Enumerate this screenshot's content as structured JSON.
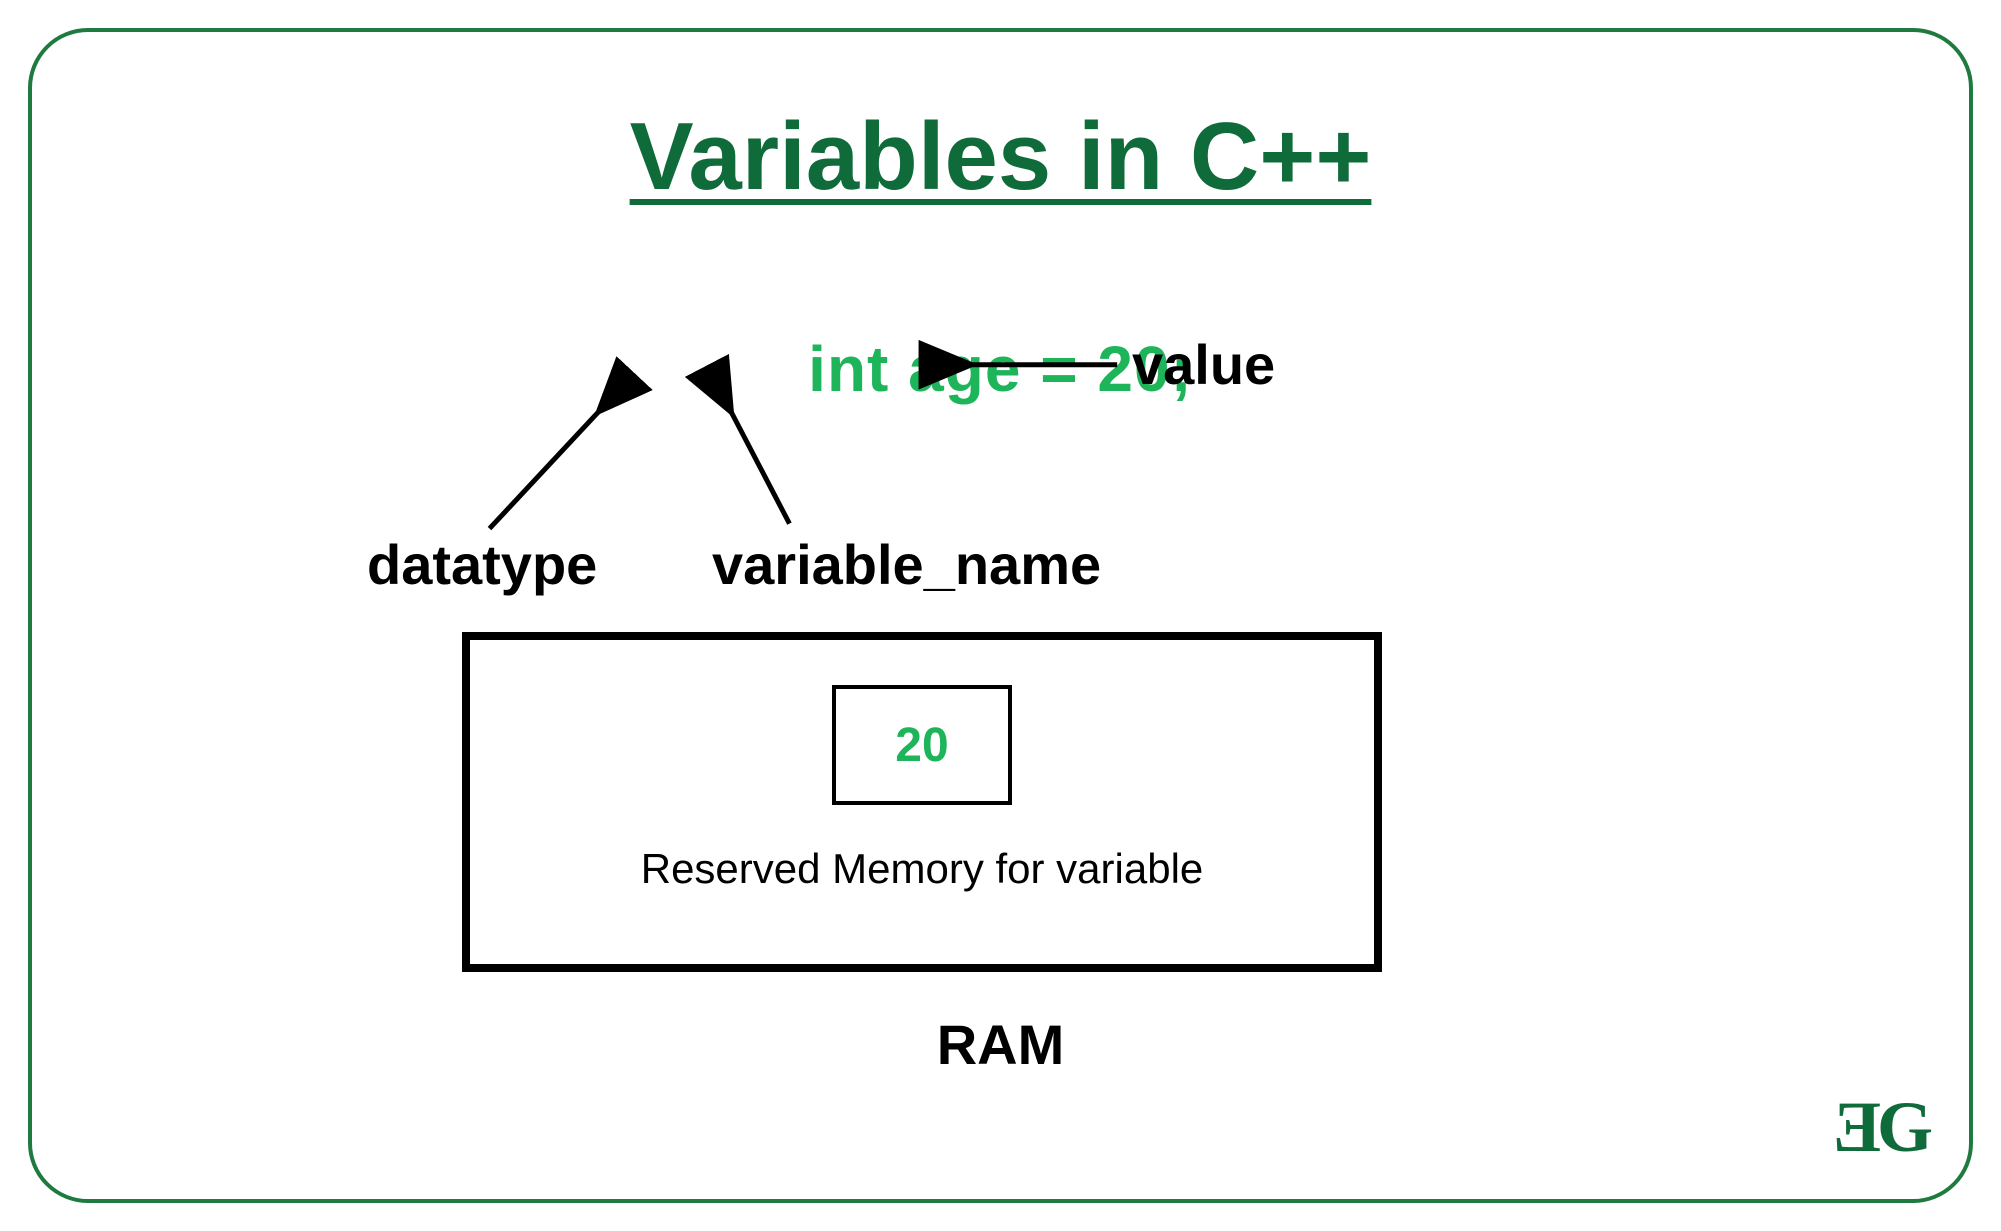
{
  "title": "Variables in C++",
  "code": "int age  = 20;",
  "labels": {
    "value": "value",
    "datatype": "datatype",
    "varname": "variable_name",
    "reserved": "Reserved Memory for variable",
    "ram": "RAM"
  },
  "memory": {
    "stored_value": "20"
  },
  "logo": "ƎG"
}
